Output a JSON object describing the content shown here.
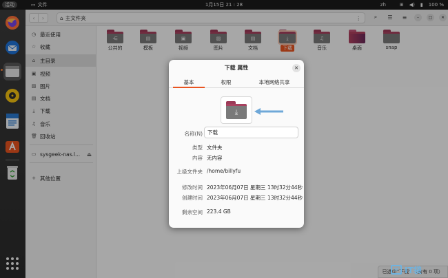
{
  "topbar": {
    "activities": "活动",
    "app_name": "文件",
    "clock": "1月15日  21 : 28",
    "lang": "zh",
    "battery": "100 %"
  },
  "window": {
    "path_label": "主文件夹",
    "view_icon": "list-view-icon",
    "status_text": "已选中“下载” （含有 0 项）"
  },
  "sidebar": {
    "items": [
      {
        "label": "最近使用",
        "icon": "clock-icon"
      },
      {
        "label": "收藏",
        "icon": "star-icon"
      },
      {
        "label": "主目录",
        "icon": "home-icon"
      },
      {
        "label": "视频",
        "icon": "video-icon"
      },
      {
        "label": "图片",
        "icon": "image-icon"
      },
      {
        "label": "文档",
        "icon": "document-icon"
      },
      {
        "label": "下载",
        "icon": "download-icon"
      },
      {
        "label": "音乐",
        "icon": "music-icon"
      },
      {
        "label": "回收站",
        "icon": "trash-icon"
      },
      {
        "label": "sysgeek-nas.l...",
        "icon": "network-drive-icon"
      },
      {
        "label": "其他位置",
        "icon": "plus-icon"
      }
    ]
  },
  "files": [
    {
      "label": "公共的",
      "icon": "share-icon"
    },
    {
      "label": "模板",
      "icon": "template-icon"
    },
    {
      "label": "视频",
      "icon": "video-icon"
    },
    {
      "label": "图片",
      "icon": "image-icon"
    },
    {
      "label": "文档",
      "icon": "document-icon"
    },
    {
      "label": "下载",
      "icon": "download-icon"
    },
    {
      "label": "音乐",
      "icon": "music-icon"
    },
    {
      "label": "桌面",
      "icon": "desktop-icon"
    },
    {
      "label": "snap",
      "icon": "folder-icon"
    }
  ],
  "dialog": {
    "title": "下载 属性",
    "tabs": [
      "基本",
      "权限",
      "本地网络共享"
    ],
    "name_label": "名称(N)",
    "name_value": "下载",
    "rows": [
      {
        "label": "类型",
        "value": "文件夹"
      },
      {
        "label": "内容",
        "value": "无内容"
      },
      {
        "label": "上级文件夹",
        "value": "/home/billyfu"
      },
      {
        "label": "修改时间",
        "value": "2023年06月07日 星期三 13时32分44秒"
      },
      {
        "label": "创建时间",
        "value": "2023年06月07日 星期三 13时32分44秒"
      },
      {
        "label": "剩余空间",
        "value": "223.4 GB"
      }
    ]
  },
  "watermark": {
    "box": "IT",
    "text": "IT袋"
  },
  "colors": {
    "accent": "#e95420",
    "folder_tab": "#a8415f",
    "arrow": "#6fa8d8"
  }
}
